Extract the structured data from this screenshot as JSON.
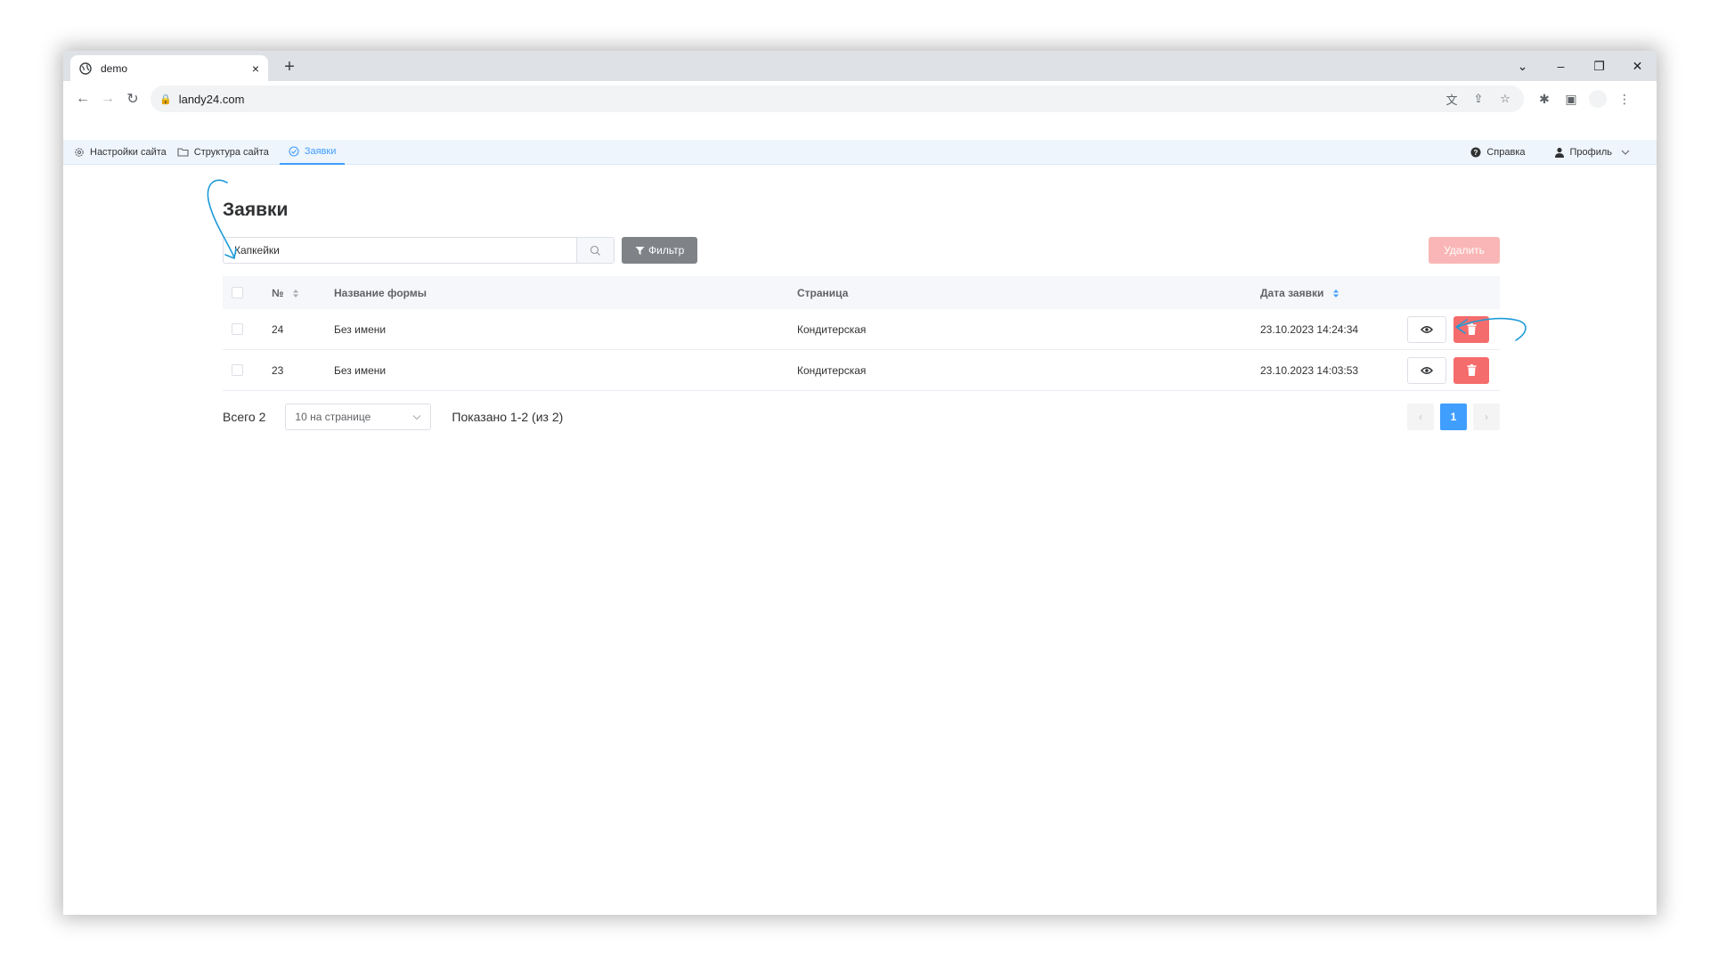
{
  "browser": {
    "tab_title": "demo",
    "tab_close": "×",
    "new_tab": "+",
    "url": "landy24.com"
  },
  "app_nav": {
    "items": [
      {
        "label": "Настройки сайта",
        "icon": "gear-icon"
      },
      {
        "label": "Структура сайта",
        "icon": "folder-icon"
      },
      {
        "label": "Заявки",
        "icon": "check-circle-icon",
        "active": true
      }
    ],
    "help_label": "Справка",
    "profile_label": "Профиль"
  },
  "page": {
    "title": "Заявки",
    "search_value": "Капкейки",
    "filter_label": "Фильтр",
    "delete_label": "Удалить"
  },
  "table": {
    "headers": {
      "num": "№",
      "form_name": "Название формы",
      "page": "Страница",
      "date": "Дата заявки"
    },
    "rows": [
      {
        "num": "24",
        "form_name": "Без имени",
        "page": "Кондитерская",
        "date": "23.10.2023 14:24:34"
      },
      {
        "num": "23",
        "form_name": "Без имени",
        "page": "Кондитерская",
        "date": "23.10.2023 14:03:53"
      }
    ]
  },
  "footer": {
    "total": "Всего 2",
    "page_size": "10 на странице",
    "shown": "Показано 1-2 (из 2)",
    "prev": "‹",
    "current_page": "1",
    "next": "›"
  },
  "colors": {
    "accent": "#409eff",
    "danger": "#f56c6c",
    "danger_disabled": "#fab6b6",
    "filter_button": "#7f8388",
    "annotation": "#1e9bd7"
  }
}
